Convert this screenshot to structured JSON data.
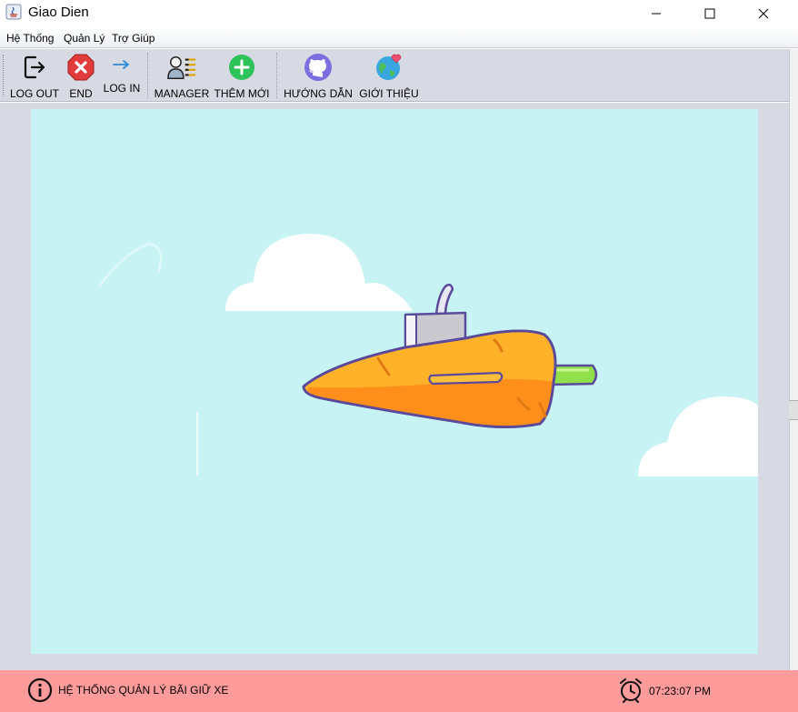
{
  "window": {
    "title": "Giao Dien"
  },
  "menu": {
    "items": [
      "Hệ Thống",
      "Quản Lý",
      "Trợ Giúp"
    ]
  },
  "toolbar": {
    "logout": "LOG OUT",
    "end": "END",
    "login": "LOG IN",
    "manager": "MANAGER",
    "add_new": "THÊM MỚI",
    "guide": "HƯỚNG DẪN",
    "about": "GIỚI THIỆU"
  },
  "illustration": {
    "subject": "carrot-rocket-in-sky",
    "sky_color": "#c8f3f4",
    "carrot_color": "#ff9a1f"
  },
  "status": {
    "message": "HỆ THỐNG QUẢN LÝ BÃI GIỮ XE",
    "time": "07:23:07 PM"
  },
  "colors": {
    "status_bar": "#ff9b9b",
    "toolbar": "#d7dae2",
    "end_icon": "#e23b3b",
    "add_icon": "#2ec25a"
  }
}
